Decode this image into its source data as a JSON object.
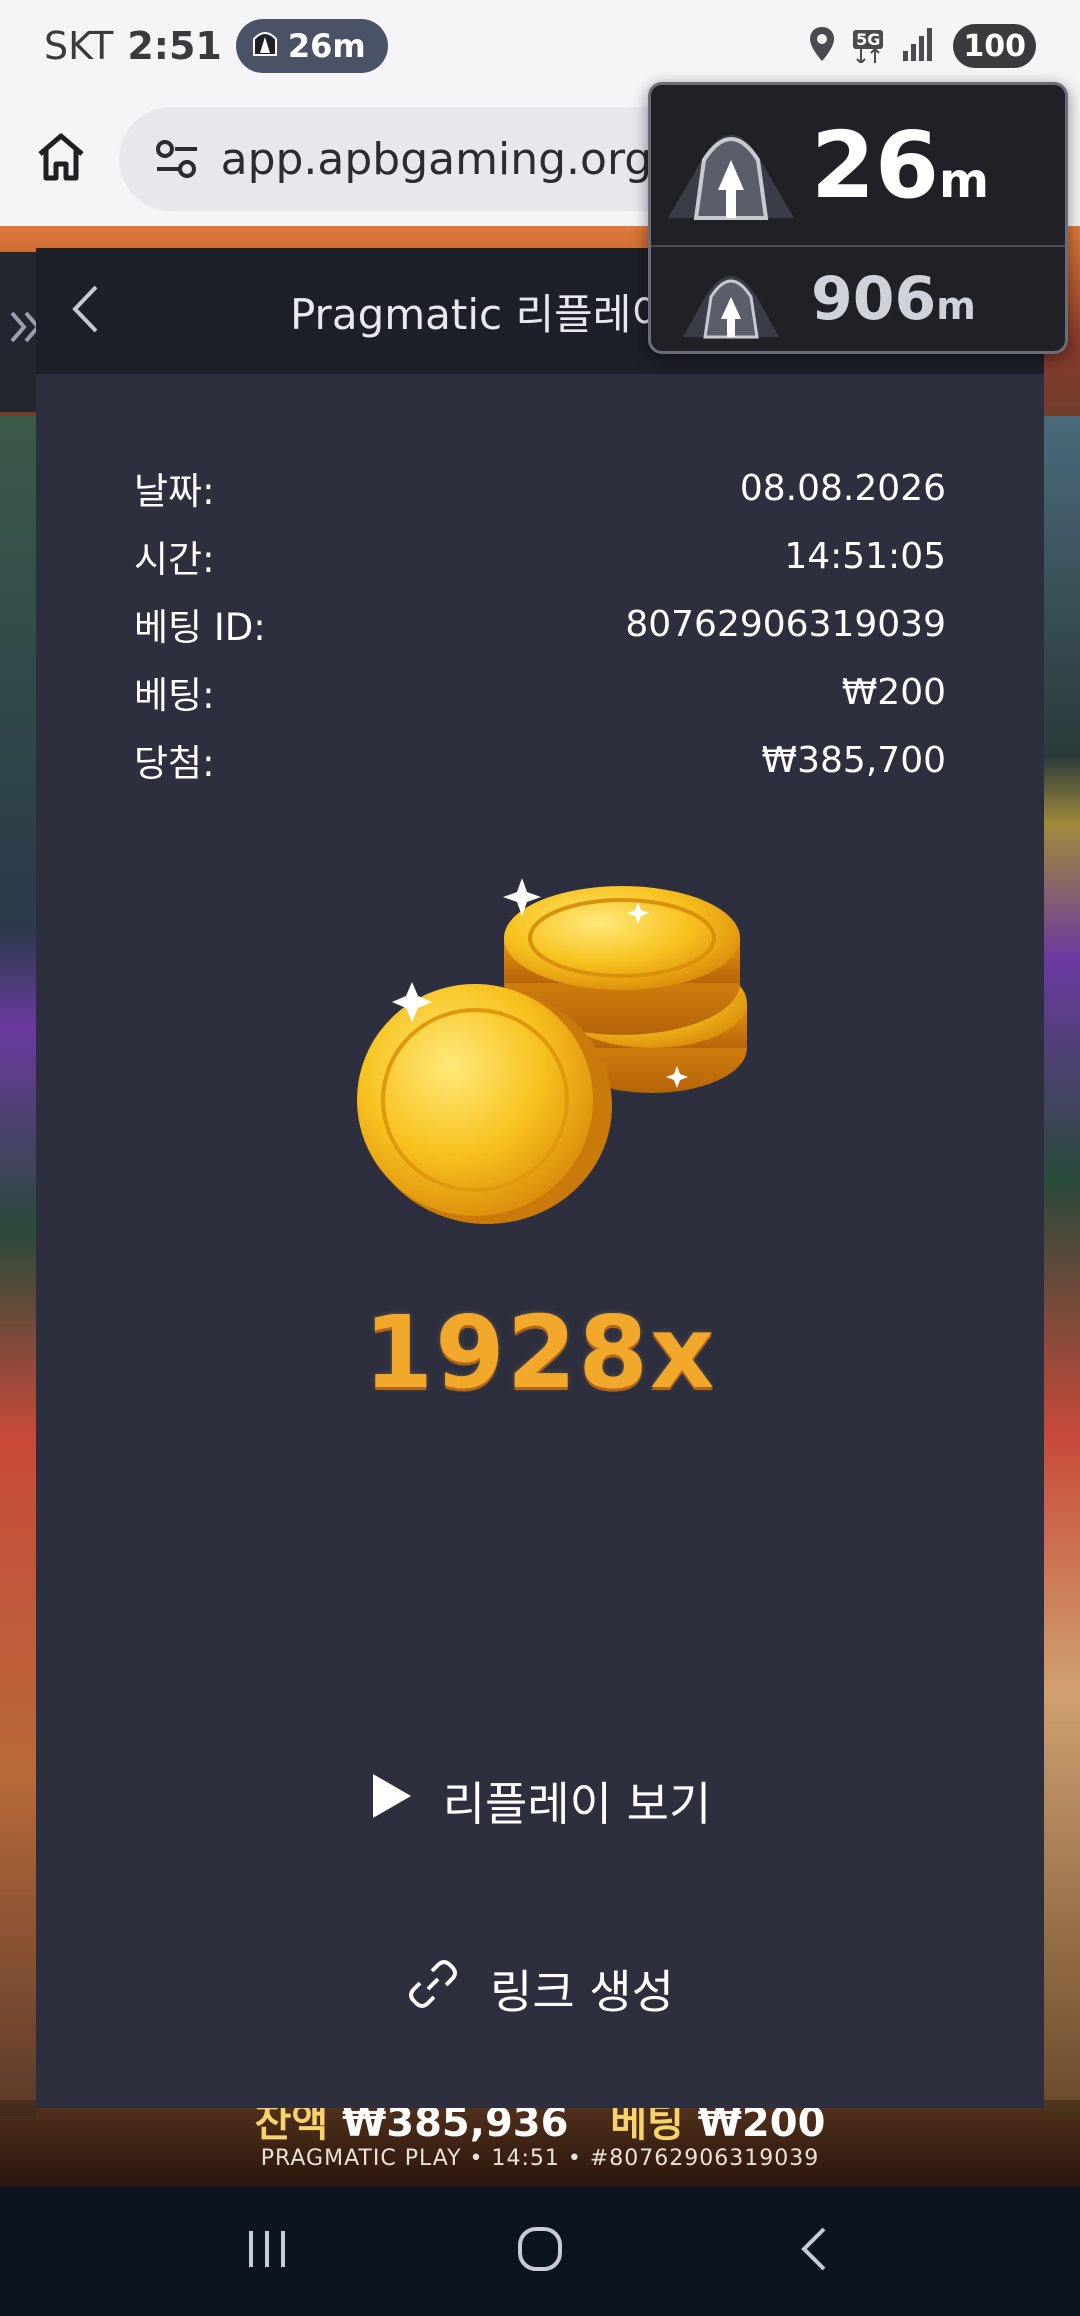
{
  "status_bar": {
    "carrier": "SKT",
    "time": "2:51",
    "nav_pill_distance": "26m",
    "network": "5G",
    "battery": "100"
  },
  "browser": {
    "url": "app.apbgaming.org/a"
  },
  "navigation_overlay": {
    "primary_distance": "26",
    "primary_unit": "m",
    "secondary_distance": "906",
    "secondary_unit": "m"
  },
  "modal": {
    "title": "Pragmatic 리플레이",
    "details": [
      {
        "label": "날짜:",
        "value": "08.08.2026"
      },
      {
        "label": "시간:",
        "value": "14:51:05"
      },
      {
        "label": "베팅 ID:",
        "value": "80762906319039"
      },
      {
        "label": "베팅:",
        "value": "₩200"
      },
      {
        "label": "당첨:",
        "value": "₩385,700"
      }
    ],
    "multiplier": "1928x",
    "replay_label": "리플레이 보기",
    "link_label": "링크 생성"
  },
  "game_footer": {
    "balance_label": "잔액",
    "balance_value": "₩385,936",
    "bet_label": "베팅",
    "bet_value": "₩200",
    "info_line": "PRAGMATIC PLAY • 14:51 • #80762906319039"
  },
  "icons": {
    "home": "home-icon",
    "site_settings": "tune-icon",
    "back": "chevron-left-icon",
    "close": "close-icon",
    "play": "play-icon",
    "link": "link-icon",
    "tunnel": "tunnel-icon",
    "location": "location-icon",
    "signal": "signal-icon"
  },
  "colors": {
    "modal_bg": "#2d2f3f",
    "modal_header_bg": "#1d1f29",
    "multiplier_gold": "#f2a82a"
  }
}
